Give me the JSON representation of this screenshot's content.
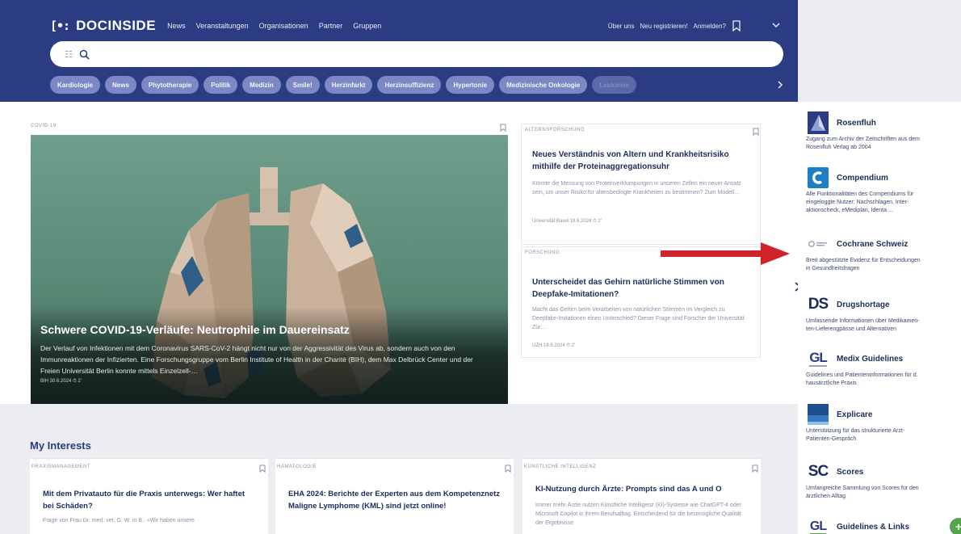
{
  "header": {
    "logo_mark": "[•:",
    "logo_text": "DOCINSIDE",
    "nav": [
      "News",
      "Veranstaltungen",
      "Organisationen",
      "Partner",
      "Gruppen"
    ],
    "user_nav": [
      "Über uns",
      "Neu registrieren!",
      "Anmelden?"
    ],
    "search": {
      "placeholder": ""
    },
    "chips": [
      "Kardiologie",
      "News",
      "Phytotherapie",
      "Politik",
      "Medizin",
      "Smile!",
      "Herzinfarkt",
      "Herzinsuffizienz",
      "Hypertonie",
      "Medizinische Onkologie",
      "Leukämie"
    ]
  },
  "feature": {
    "tag": "COVID-19",
    "title": "Schwere COVID-19-Verläufe: Neutrophile im Dauereinsatz",
    "excerpt": "Der Verlauf von Infektionen mit dem Coronavirus SARS-CoV-2 hängt nicht nur von der Aggressivität des Virus ab, sondern auch von den Immunreaktionen der Infizierten. Eine Forschungsgruppe vom Berlin Institute of Health in der Charité (BIH), dem Max Delbrück Center und der Freien Universität Berlin konnte mittels Einzelzell-…",
    "meta": "BIH 30.6.2024 ⏱ 2'"
  },
  "side_cards": [
    {
      "tag": "ALTERNSFORSCHUNG",
      "title": "Neues Verständnis von Altern und Krankheitsrisiko mithilfe der Proteinaggregationsuhr",
      "excerpt": "Könnte die Messung von Proteinverklumpungen in unseren Zellen ein neuer Ansatz sein, um unser Risiko für altersbedingte Krankheiten zu bestimmen? Zum Modell…",
      "meta": "Universität Basel 18.6.2024 ⏱ 2'"
    },
    {
      "tag": "FORSCHUNG",
      "title": "Unterscheidet das Gehirn natürliche Stimmen von Deepfake-Imitationen?",
      "excerpt": "Macht das Gehirn beim Verarbeiten von natürlichen Stimmen im Vergleich zu Deepfake-Imitationen einen Unterschied? Dieser Frage sind Forscher der Universität Zür…",
      "meta": "UZH 18.6.2024 ⏱ 2'"
    }
  ],
  "interests": {
    "heading": "My Interests",
    "cards": [
      {
        "tag": "PRAXISMANAGEMENT",
        "title": "Mit dem Privatauto für die Praxis unterwegs: Wer haftet bei Schäden?",
        "excerpt": "Frage von Frau Dr. med. vet. G. W. in B.: «Wir haben unsere"
      },
      {
        "tag": "HÄMATOLOGIE",
        "title": "EHA 2024: Berichte der Experten aus dem Kompetenznetz Maligne Lymphome (KML) sind jetzt online!",
        "excerpt": ""
      },
      {
        "tag": "KÜNSTLICHE INTELLIGENZ",
        "title": "KI-Nutzung durch Ärzte: Prompts sind das A und O",
        "excerpt": "Immer mehr Ärzte nutzen Künstliche Intelligenz (KI)-Systeme wie ChatGPT-4 oder Microsoft Copilot in ihrem Berufsalltag. Entscheidend für die bestmögliche Qualität der Ergebnisse"
      }
    ]
  },
  "sidebar": [
    {
      "name": "Rosenfluh",
      "desc": [
        "Zugang zum Archiv der Zeitschriften aus dem",
        "Rosenfluh Verlag ab 2004"
      ],
      "icon": "rosenfluh-logo",
      "color": "#2c3c83"
    },
    {
      "name": "Compendium",
      "desc": [
        "Alle Funktionalitäten des Compendiums für",
        "eingeloggte Nutzer: Nachschlagen, Inter-",
        "aktionscheck, eMediplan, Identa ..."
      ],
      "icon": "compendium-logo",
      "color": "#1f7fc4"
    },
    {
      "name": "Cochrane Schweiz",
      "desc": [
        "Breit abgestützte Evidenz für Entscheidungen",
        "in Gesundheitsfragen"
      ],
      "icon": "cochrane-logo",
      "color": "#9aa0b4"
    },
    {
      "name": "Drugshortage",
      "desc": [
        "Umfassende Informationen über Medikamen-",
        "ten-Lieferengpässe und Alternativen"
      ],
      "icon": "ds-logo",
      "color": "#1d2a5a"
    },
    {
      "name": "Medix Guidelines",
      "desc": [
        "Guidelines und Patienteninformationen für d.",
        "hausärztliche Praxis"
      ],
      "icon": "gl-logo",
      "color": "#2c3c83"
    },
    {
      "name": "Explicare",
      "desc": [
        "Unterstützung für das strukturierte Arzt-",
        "Patienten-Gespräch"
      ],
      "icon": "explicare-logo",
      "color": "#1f4f8f"
    },
    {
      "name": "Scores",
      "desc": [
        "Umfangreiche Sammlung von Scores für den",
        "ärztlichen Alltag"
      ],
      "icon": "sc-logo",
      "color": "#1d2a5a"
    },
    {
      "name": "Guidelines & Links",
      "desc": [],
      "icon": "gl-links-logo",
      "color": "#56a44b"
    }
  ],
  "colors": {
    "header_bg": "#2c3c83",
    "chip_bg": "#7c88c3",
    "annotation_arrow": "#d0232a"
  }
}
